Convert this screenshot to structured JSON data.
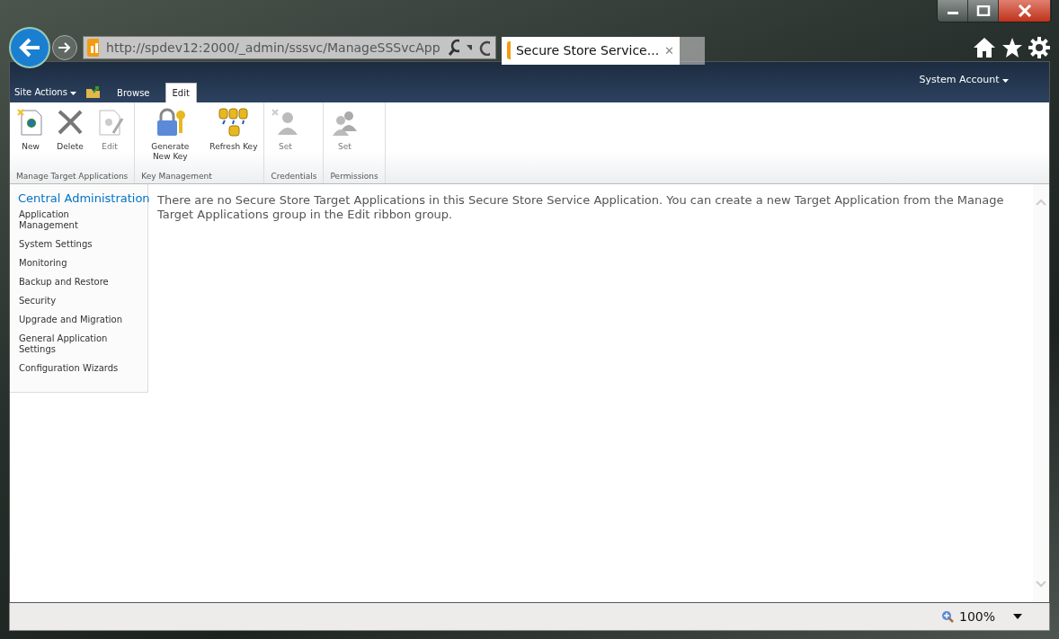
{
  "browser": {
    "address": "http://spdev12:2000/_admin/sssvc/ManageSSSvcApp",
    "tab_title": "Secure Store Service...",
    "tab_close": "✕"
  },
  "header": {
    "site_actions": "Site Actions",
    "user": "System Account"
  },
  "ribbon_tabs": [
    {
      "label": "Browse",
      "selected": false
    },
    {
      "label": "Edit",
      "selected": true
    }
  ],
  "ribbon_groups": [
    {
      "label": "Manage Target Applications",
      "buttons": [
        {
          "kind": "new",
          "label": "New",
          "disabled": false
        },
        {
          "kind": "delete",
          "label": "Delete",
          "disabled": false
        },
        {
          "kind": "edit",
          "label": "Edit",
          "disabled": true
        }
      ]
    },
    {
      "label": "Key Management",
      "buttons": [
        {
          "kind": "key",
          "label": "Generate New Key",
          "disabled": false
        },
        {
          "kind": "refresh",
          "label": "Refresh Key",
          "disabled": false
        }
      ]
    },
    {
      "label": "Credentials",
      "buttons": [
        {
          "kind": "user",
          "label": "Set",
          "disabled": true
        }
      ]
    },
    {
      "label": "Permissions",
      "buttons": [
        {
          "kind": "users",
          "label": "Set",
          "disabled": true
        }
      ]
    }
  ],
  "sidebar": {
    "title": "Central Administration",
    "items": [
      {
        "label": "Application Management"
      },
      {
        "label": "System Settings"
      },
      {
        "label": "Monitoring"
      },
      {
        "label": "Backup and Restore"
      },
      {
        "label": "Security"
      },
      {
        "label": "Upgrade and Migration"
      },
      {
        "label": "General Application Settings"
      },
      {
        "label": "Configuration Wizards"
      }
    ]
  },
  "message": "There are no Secure Store Target Applications in this Secure Store Service Application. You can create a new Target Application from the Manage Target Applications group in the Edit ribbon group.",
  "status_bar": {
    "zoom": "100%"
  }
}
